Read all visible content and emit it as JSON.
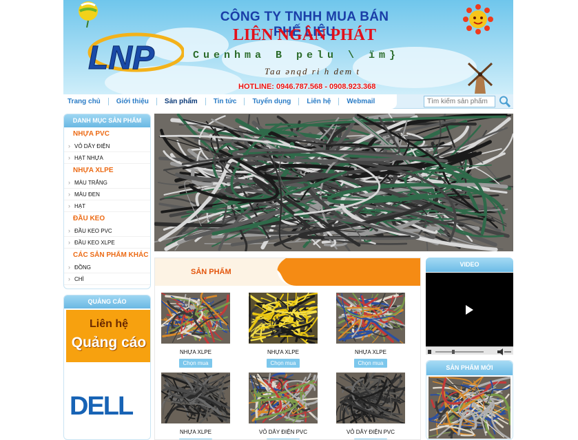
{
  "header": {
    "logo_text": "LNP",
    "company_line1": "CÔNG TY TNHH MUA BÁN PHẾ LIỆU",
    "company_line2": "LIÊN NGÂN PHÁT",
    "slogan_line1": "Cuenhma B pelu \\ ïm}",
    "slogan_line2": "Taa ǝnqd ri h dem t",
    "hotline": "HOTLINE: 0946.787.568 - 0908.923.368"
  },
  "nav": {
    "items": [
      "Trang chủ",
      "Giới thiệu",
      "Sản phẩm",
      "Tin tức",
      "Tuyển dụng",
      "Liên hệ",
      "Webmail"
    ],
    "active_index": 2
  },
  "search": {
    "placeholder": "Tìm kiếm sản phẩm"
  },
  "sidebar": {
    "title": "DANH MỤC SẢN PHẨM",
    "groups": [
      {
        "title": "NHỰA PVC",
        "items": [
          "VỎ DÂY ĐIỆN",
          "HẠT NHỰA"
        ]
      },
      {
        "title": "NHỰA XLPE",
        "items": [
          "MÀU TRẮNG",
          "MÀU ĐEN",
          "HẠT"
        ]
      },
      {
        "title": "ĐẦU KEO",
        "items": [
          "ĐẦU KEO PVC",
          "ĐẦU KEO XLPE"
        ]
      },
      {
        "title": "CÁC SẢN PHẨM KHÁC",
        "items": [
          "ĐỒNG",
          "CHÌ"
        ]
      }
    ]
  },
  "ads": {
    "title": "QUẢNG CÁO",
    "banner_line1": "Liên hệ",
    "banner_line2": "Quảng cáo",
    "brand": "DELL"
  },
  "products": {
    "title": "SẢN PHẨM",
    "buy_label": "Chọn mua",
    "items": [
      {
        "name": "NHỰA XLPE"
      },
      {
        "name": "NHỰA XLPE"
      },
      {
        "name": "NHỰA XLPE"
      },
      {
        "name": "NHỰA XLPE"
      },
      {
        "name": "VỎ DÂY ĐIỆN PVC"
      },
      {
        "name": "VỎ DÂY ĐIỆN PVC"
      }
    ]
  },
  "video": {
    "title": "VIDEO"
  },
  "new_products": {
    "title": "SẢN PHẨM MỚI"
  },
  "colors": {
    "accent_blue": "#2a7cc6",
    "category_orange": "#ec6a14",
    "hotline_red": "#e81010",
    "header_sky": "#6fc6ec"
  }
}
